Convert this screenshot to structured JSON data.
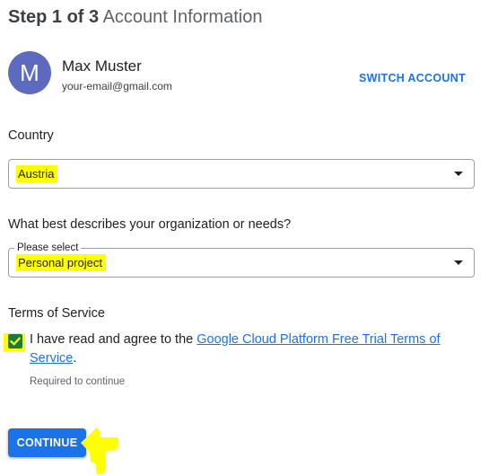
{
  "step": {
    "count": "Step 1 of 3",
    "title": "Account Information"
  },
  "account": {
    "avatar_initial": "M",
    "name": "Max Muster",
    "email": "your-email@gmail.com",
    "switch_label": "SWITCH ACCOUNT"
  },
  "country": {
    "label": "Country",
    "value": "Austria"
  },
  "organization": {
    "label": "What best describes your organization or needs?",
    "float_label": "Please select",
    "value": "Personal project"
  },
  "terms": {
    "label": "Terms of Service",
    "checked": true,
    "text_before": "I have read and agree to the ",
    "link_text": "Google Cloud Platform Free Trial Terms of Service",
    "text_after": ".",
    "helper": "Required to continue"
  },
  "actions": {
    "continue_label": "CONTINUE"
  },
  "colors": {
    "accent": "#1a73e8",
    "avatar": "#5c6bc0",
    "highlight": "#ffff00",
    "checkbox": "#1b7a3a"
  },
  "icons": {
    "select_caret": "chevron-down-icon",
    "checkbox_mark": "checkmark-icon",
    "annotation": "pointing-hand-icon"
  }
}
